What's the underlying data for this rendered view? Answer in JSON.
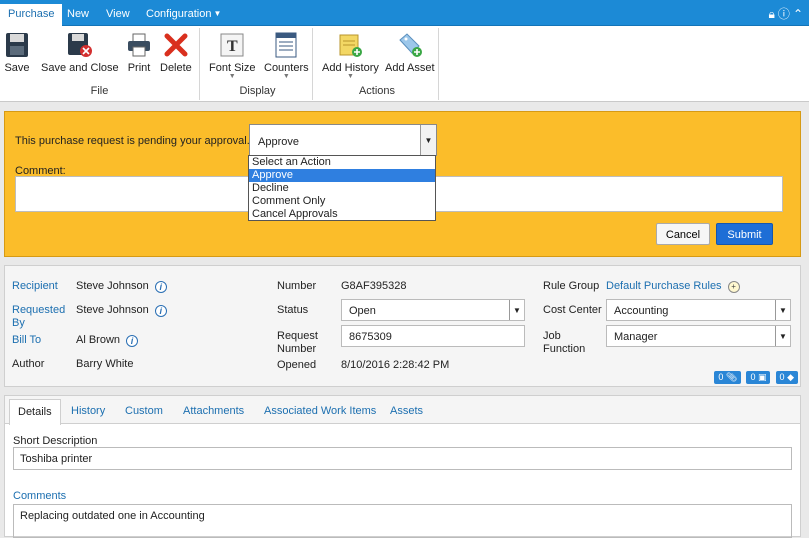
{
  "topbar": {
    "tabs": [
      "Purchase",
      "New",
      "View",
      "Configuration"
    ],
    "icons": [
      "lock-icon",
      "info-icon",
      "collapse-icon"
    ]
  },
  "ribbon": {
    "file": {
      "label": "File",
      "buttons": [
        "Save",
        "Save and Close",
        "Print",
        "Delete"
      ]
    },
    "display": {
      "label": "Display",
      "buttons": [
        "Font Size",
        "Counters"
      ]
    },
    "actions": {
      "label": "Actions",
      "buttons": [
        "Add History",
        "Add Asset"
      ]
    }
  },
  "approval": {
    "message": "This purchase request is pending your approval.",
    "selected": "Approve",
    "options": [
      "Select an Action",
      "Approve",
      "Decline",
      "Comment Only",
      "Cancel Approvals"
    ],
    "comment_label": "Comment:",
    "comment_value": "",
    "cancel": "Cancel",
    "submit": "Submit"
  },
  "info": {
    "recipient_label": "Recipient",
    "recipient": "Steve Johnson",
    "requested_label": "Requested By",
    "requested": "Steve Johnson",
    "billto_label": "Bill To",
    "billto": "Al Brown",
    "author_label": "Author",
    "author": "Barry White",
    "number_label": "Number",
    "number": "G8AF395328",
    "status_label": "Status",
    "status": "Open",
    "reqnum_label": "Request Number",
    "reqnum": "8675309",
    "opened_label": "Opened",
    "opened": "8/10/2016 2:28:42 PM",
    "rulegroup_label": "Rule Group",
    "rulegroup": "Default Purchase Rules",
    "costcenter_label": "Cost Center",
    "costcenter": "Accounting",
    "jobfunction_label": "Job Function",
    "jobfunction": "Manager",
    "badges": [
      "0",
      "0",
      "0"
    ]
  },
  "tabs": [
    "Details",
    "History",
    "Custom",
    "Attachments",
    "Associated Work Items",
    "Assets"
  ],
  "details": {
    "short_desc_label": "Short Description",
    "short_desc": "Toshiba printer",
    "comments_label": "Comments",
    "comments": "Replacing outdated one in Accounting"
  },
  "colors": {
    "accent": "#1c8ad6",
    "approval_bg": "#fbbd2a",
    "submit": "#1e6ed6"
  }
}
